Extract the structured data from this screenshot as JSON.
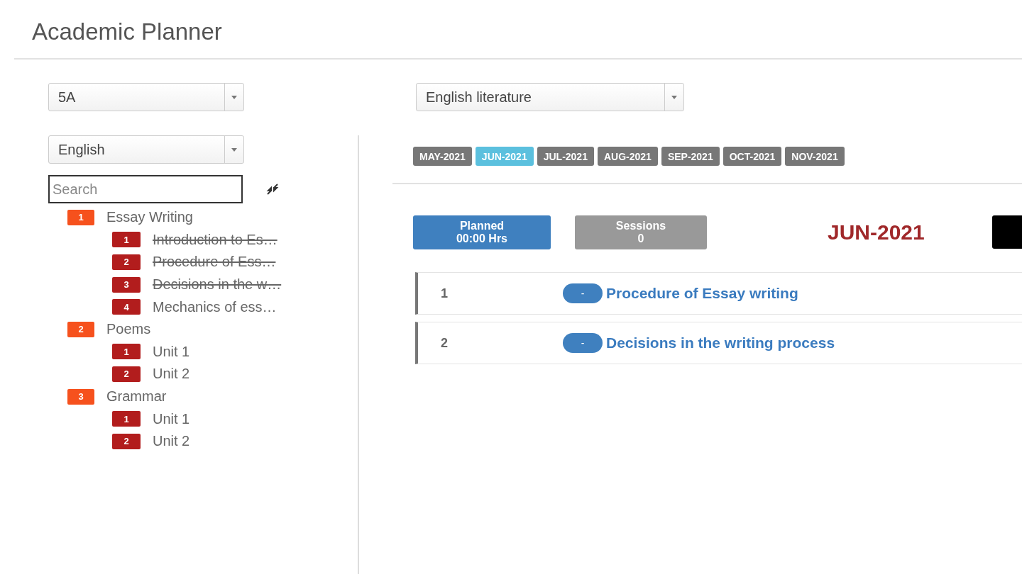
{
  "title": "Academic Planner",
  "class_select": {
    "value": "5A"
  },
  "book_select": {
    "value": "English literature"
  },
  "subject_select": {
    "value": "English"
  },
  "search": {
    "placeholder": "Search"
  },
  "tree": [
    {
      "number": "1",
      "label": "Essay Writing",
      "children": [
        {
          "number": "1",
          "label": "Introduction to Es…",
          "done": true
        },
        {
          "number": "2",
          "label": "Procedure of Ess…",
          "done": true
        },
        {
          "number": "3",
          "label": "Decisions in the w…",
          "done": true
        },
        {
          "number": "4",
          "label": "Mechanics of ess…",
          "done": false
        }
      ]
    },
    {
      "number": "2",
      "label": "Poems",
      "children": [
        {
          "number": "1",
          "label": "Unit 1",
          "done": false
        },
        {
          "number": "2",
          "label": "Unit 2",
          "done": false
        }
      ]
    },
    {
      "number": "3",
      "label": "Grammar",
      "children": [
        {
          "number": "1",
          "label": "Unit 1",
          "done": false
        },
        {
          "number": "2",
          "label": "Unit 2",
          "done": false
        }
      ]
    }
  ],
  "months": [
    {
      "label": "MAY-2021",
      "selected": false
    },
    {
      "label": "JUN-2021",
      "selected": true
    },
    {
      "label": "JUL-2021",
      "selected": false
    },
    {
      "label": "AUG-2021",
      "selected": false
    },
    {
      "label": "SEP-2021",
      "selected": false
    },
    {
      "label": "OCT-2021",
      "selected": false
    },
    {
      "label": "NOV-2021",
      "selected": false
    }
  ],
  "stats": [
    {
      "kind": "planned",
      "label": "Planned",
      "value": "00:00 Hrs"
    },
    {
      "kind": "sessions",
      "label": "Sessions",
      "value": "0"
    }
  ],
  "month_title": "JUN-2021",
  "sessions": [
    {
      "number": "1",
      "toggle": "-",
      "title": "Procedure of Essay writing"
    },
    {
      "number": "2",
      "toggle": "-",
      "title": "Decisions in the writing process"
    }
  ]
}
